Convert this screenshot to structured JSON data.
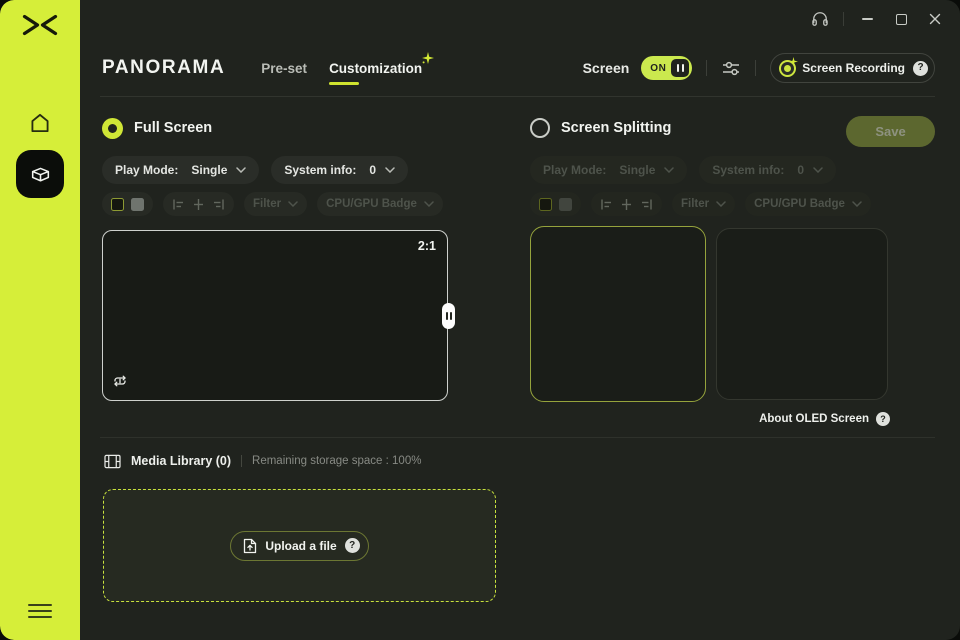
{
  "header": {
    "title": "PANORAMA",
    "tabs": [
      {
        "label": "Pre-set"
      },
      {
        "label": "Customization"
      }
    ],
    "screen_label": "Screen",
    "screen_toggle_state": "ON",
    "recording_label": "Screen Recording"
  },
  "full_screen": {
    "title": "Full Screen",
    "play_mode_label": "Play Mode:",
    "play_mode_value": "Single",
    "system_info_label": "System info:",
    "system_info_value": "0",
    "filter_label": "Filter",
    "badge_label": "CPU/GPU Badge",
    "aspect_ratio": "2:1"
  },
  "screen_splitting": {
    "title": "Screen Splitting",
    "save_label": "Save",
    "play_mode_label": "Play Mode:",
    "play_mode_value": "Single",
    "system_info_label": "System info:",
    "system_info_value": "0",
    "filter_label": "Filter",
    "badge_label": "CPU/GPU Badge",
    "about_label": "About OLED Screen"
  },
  "media_library": {
    "title": "Media Library (0)",
    "storage_text": "Remaining storage space : 100%",
    "upload_label": "Upload a file"
  },
  "icons": {
    "help": "?"
  },
  "colors": {
    "sidebar_lime": "#d6ee39",
    "toggle_lime": "#cbe94e",
    "tab_underline": "#cfe32f",
    "selected_border": "#95a33c",
    "save_olive": "#5c672f",
    "upload_dash": "#c8e23c",
    "background": "#20231e"
  }
}
